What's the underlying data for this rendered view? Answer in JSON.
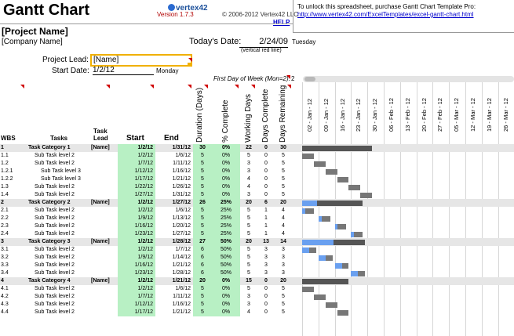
{
  "header": {
    "title": "Gantt Chart",
    "logo": "vertex42",
    "version": "Version 1.7.3",
    "copyright": "© 2006-2012 Vertex42 LLC",
    "help": "HELP",
    "promo_text": "To unlock this spreadsheet, purchase Gantt Chart Template Pro:",
    "promo_link": "http://www.vertex42.com/ExcelTemplates/excel-gantt-chart.html"
  },
  "project": {
    "name": "[Project Name]",
    "company": "[Company Name]",
    "today_label": "Today's Date:",
    "today_value": "2/24/09",
    "today_day": "Tuesday",
    "today_note": "(vertical red line)",
    "lead_label": "Project Lead:",
    "lead_value": "[Name]",
    "start_label": "Start Date:",
    "start_value": "1/2/12",
    "start_day": "Monday",
    "fdow_label": "First Day of Week (Mon=2):",
    "fdow_value": "2"
  },
  "columns": {
    "wbs": "WBS",
    "tasks": "Tasks",
    "lead": "Task Lead",
    "start": "Start",
    "end": "End",
    "duration": "Duration (Days)",
    "pct": "% Complete",
    "working": "Working Days",
    "complete": "Days Complete",
    "remaining": "Days Remaining"
  },
  "dates": [
    "02 - Jan - 12",
    "09 - Jan - 12",
    "16 - Jan - 12",
    "23 - Jan - 12",
    "30 - Jan - 12",
    "06 - Feb - 12",
    "13 - Feb - 12",
    "20 - Feb - 12",
    "27 - Feb - 12",
    "05 - Mar - 12",
    "12 - Mar - 12",
    "19 - Mar - 12",
    "26 - Mar - 12"
  ],
  "rows": [
    {
      "wbs": "1",
      "task": "Task Category 1",
      "lead": "[Name]",
      "start": "1/2/12",
      "end": "1/31/12",
      "dur": "30",
      "pct": "0%",
      "wd": "22",
      "dc": "0",
      "dr": "30",
      "cat": true,
      "indent": 0,
      "bar": [
        0,
        30
      ],
      "done": 0
    },
    {
      "wbs": "1.1",
      "task": "Sub Task level 2",
      "lead": "",
      "start": "1/2/12",
      "end": "1/6/12",
      "dur": "5",
      "pct": "0%",
      "wd": "5",
      "dc": "0",
      "dr": "5",
      "cat": false,
      "indent": 1,
      "bar": [
        0,
        5
      ],
      "done": 0
    },
    {
      "wbs": "1.2",
      "task": "Sub Task level 2",
      "lead": "",
      "start": "1/7/12",
      "end": "1/11/12",
      "dur": "5",
      "pct": "0%",
      "wd": "3",
      "dc": "0",
      "dr": "5",
      "cat": false,
      "indent": 1,
      "bar": [
        5,
        5
      ],
      "done": 0
    },
    {
      "wbs": "1.2.1",
      "task": "Sub Task level 3",
      "lead": "",
      "start": "1/12/12",
      "end": "1/16/12",
      "dur": "5",
      "pct": "0%",
      "wd": "3",
      "dc": "0",
      "dr": "5",
      "cat": false,
      "indent": 2,
      "bar": [
        10,
        5
      ],
      "done": 0
    },
    {
      "wbs": "1.2.2",
      "task": "Sub Task level 3",
      "lead": "",
      "start": "1/17/12",
      "end": "1/21/12",
      "dur": "5",
      "pct": "0%",
      "wd": "4",
      "dc": "0",
      "dr": "5",
      "cat": false,
      "indent": 2,
      "bar": [
        15,
        5
      ],
      "done": 0
    },
    {
      "wbs": "1.3",
      "task": "Sub Task level 2",
      "lead": "",
      "start": "1/22/12",
      "end": "1/26/12",
      "dur": "5",
      "pct": "0%",
      "wd": "4",
      "dc": "0",
      "dr": "5",
      "cat": false,
      "indent": 1,
      "bar": [
        20,
        5
      ],
      "done": 0
    },
    {
      "wbs": "1.4",
      "task": "Sub Task level 2",
      "lead": "",
      "start": "1/27/12",
      "end": "1/31/12",
      "dur": "5",
      "pct": "0%",
      "wd": "3",
      "dc": "0",
      "dr": "5",
      "cat": false,
      "indent": 1,
      "bar": [
        25,
        5
      ],
      "done": 0
    },
    {
      "wbs": "2",
      "task": "Task Category 2",
      "lead": "[Name]",
      "start": "1/2/12",
      "end": "1/27/12",
      "dur": "26",
      "pct": "25%",
      "wd": "20",
      "dc": "6",
      "dr": "20",
      "cat": true,
      "indent": 0,
      "bar": [
        0,
        26
      ],
      "done": 0.25
    },
    {
      "wbs": "2.1",
      "task": "Sub Task level 2",
      "lead": "",
      "start": "1/2/12",
      "end": "1/6/12",
      "dur": "5",
      "pct": "25%",
      "wd": "5",
      "dc": "1",
      "dr": "4",
      "cat": false,
      "indent": 1,
      "bar": [
        0,
        5
      ],
      "done": 0.25
    },
    {
      "wbs": "2.2",
      "task": "Sub Task level 2",
      "lead": "",
      "start": "1/9/12",
      "end": "1/13/12",
      "dur": "5",
      "pct": "25%",
      "wd": "5",
      "dc": "1",
      "dr": "4",
      "cat": false,
      "indent": 1,
      "bar": [
        7,
        5
      ],
      "done": 0.25
    },
    {
      "wbs": "2.3",
      "task": "Sub Task level 2",
      "lead": "",
      "start": "1/16/12",
      "end": "1/20/12",
      "dur": "5",
      "pct": "25%",
      "wd": "5",
      "dc": "1",
      "dr": "4",
      "cat": false,
      "indent": 1,
      "bar": [
        14,
        5
      ],
      "done": 0.25
    },
    {
      "wbs": "2.4",
      "task": "Sub Task level 2",
      "lead": "",
      "start": "1/23/12",
      "end": "1/27/12",
      "dur": "5",
      "pct": "25%",
      "wd": "5",
      "dc": "1",
      "dr": "4",
      "cat": false,
      "indent": 1,
      "bar": [
        21,
        5
      ],
      "done": 0.25
    },
    {
      "wbs": "3",
      "task": "Task Category 3",
      "lead": "[Name]",
      "start": "1/2/12",
      "end": "1/28/12",
      "dur": "27",
      "pct": "50%",
      "wd": "20",
      "dc": "13",
      "dr": "14",
      "cat": true,
      "indent": 0,
      "bar": [
        0,
        27
      ],
      "done": 0.5
    },
    {
      "wbs": "3.1",
      "task": "Sub Task level 2",
      "lead": "",
      "start": "1/2/12",
      "end": "1/7/12",
      "dur": "6",
      "pct": "50%",
      "wd": "5",
      "dc": "3",
      "dr": "3",
      "cat": false,
      "indent": 1,
      "bar": [
        0,
        6
      ],
      "done": 0.5
    },
    {
      "wbs": "3.2",
      "task": "Sub Task level 2",
      "lead": "",
      "start": "1/9/12",
      "end": "1/14/12",
      "dur": "6",
      "pct": "50%",
      "wd": "5",
      "dc": "3",
      "dr": "3",
      "cat": false,
      "indent": 1,
      "bar": [
        7,
        6
      ],
      "done": 0.5
    },
    {
      "wbs": "3.3",
      "task": "Sub Task level 2",
      "lead": "",
      "start": "1/16/12",
      "end": "1/21/12",
      "dur": "6",
      "pct": "50%",
      "wd": "5",
      "dc": "3",
      "dr": "3",
      "cat": false,
      "indent": 1,
      "bar": [
        14,
        6
      ],
      "done": 0.5
    },
    {
      "wbs": "3.4",
      "task": "Sub Task level 2",
      "lead": "",
      "start": "1/23/12",
      "end": "1/28/12",
      "dur": "6",
      "pct": "50%",
      "wd": "5",
      "dc": "3",
      "dr": "3",
      "cat": false,
      "indent": 1,
      "bar": [
        21,
        6
      ],
      "done": 0.5
    },
    {
      "wbs": "4",
      "task": "Task Category 4",
      "lead": "[Name]",
      "start": "1/2/12",
      "end": "1/21/12",
      "dur": "20",
      "pct": "0%",
      "wd": "15",
      "dc": "0",
      "dr": "20",
      "cat": true,
      "indent": 0,
      "bar": [
        0,
        20
      ],
      "done": 0
    },
    {
      "wbs": "4.1",
      "task": "Sub Task level 2",
      "lead": "",
      "start": "1/2/12",
      "end": "1/6/12",
      "dur": "5",
      "pct": "0%",
      "wd": "5",
      "dc": "0",
      "dr": "5",
      "cat": false,
      "indent": 1,
      "bar": [
        0,
        5
      ],
      "done": 0
    },
    {
      "wbs": "4.2",
      "task": "Sub Task level 2",
      "lead": "",
      "start": "1/7/12",
      "end": "1/11/12",
      "dur": "5",
      "pct": "0%",
      "wd": "3",
      "dc": "0",
      "dr": "5",
      "cat": false,
      "indent": 1,
      "bar": [
        5,
        5
      ],
      "done": 0
    },
    {
      "wbs": "4.3",
      "task": "Sub Task level 2",
      "lead": "",
      "start": "1/12/12",
      "end": "1/16/12",
      "dur": "5",
      "pct": "0%",
      "wd": "3",
      "dc": "0",
      "dr": "5",
      "cat": false,
      "indent": 1,
      "bar": [
        10,
        5
      ],
      "done": 0
    },
    {
      "wbs": "4.4",
      "task": "Sub Task level 2",
      "lead": "",
      "start": "1/17/12",
      "end": "1/21/12",
      "dur": "5",
      "pct": "0%",
      "wd": "4",
      "dc": "0",
      "dr": "5",
      "cat": false,
      "indent": 1,
      "bar": [
        15,
        5
      ],
      "done": 0
    }
  ],
  "colors": {
    "start_fill": "#b8f0c4",
    "category_row": "#e6e6e6",
    "bar_task": "#777777",
    "bar_done": "#6aa0f0",
    "lead_highlight": "#f0b000"
  }
}
